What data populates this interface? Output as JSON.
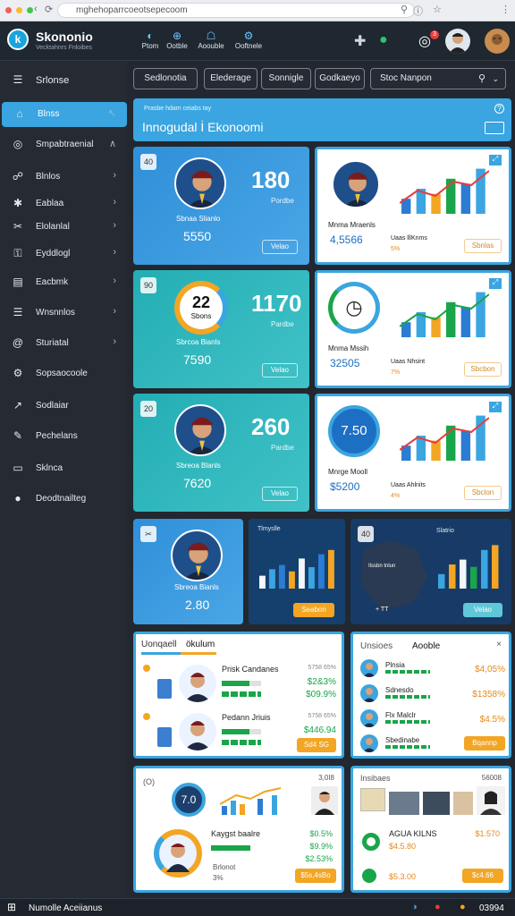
{
  "browser": {
    "url": "mghehoparrcoeotsepecoom"
  },
  "app": {
    "logo_letter": "k",
    "name": "Skononio",
    "tagline": "Vecktahnrs Fnloibes"
  },
  "topnav": [
    {
      "icon": "◐",
      "label": "Ptom"
    },
    {
      "icon": "⊕",
      "label": "Ootble"
    },
    {
      "icon": "☖",
      "label": "Aoouble"
    },
    {
      "icon": "⚙",
      "label": "Ooftnele"
    }
  ],
  "notif_count": "3",
  "sidebar": {
    "header": "Srlonse",
    "items": [
      {
        "icon": "⌂",
        "label": "Blnss",
        "chev": "↖",
        "active": true
      },
      {
        "icon": "◎",
        "label": "Smpabtraenial",
        "chev": "∧"
      },
      {
        "icon": "☍",
        "label": "Blnlos",
        "chev": "›"
      },
      {
        "icon": "✱",
        "label": "Eablaa",
        "chev": "›"
      },
      {
        "icon": "✂",
        "label": "Elolanlal",
        "chev": "›"
      },
      {
        "icon": "⚿",
        "label": "Eyddlogl",
        "chev": "›"
      },
      {
        "icon": "▤",
        "label": "Eacbmk",
        "chev": "›"
      },
      {
        "icon": "☰",
        "label": "Wnsnnlos",
        "chev": "›"
      },
      {
        "icon": "@",
        "label": "Sturiatal",
        "chev": "›"
      },
      {
        "icon": "⚙",
        "label": "Sopsaocoole",
        "chev": ""
      },
      {
        "icon": "↗",
        "label": "Sodlaiar",
        "chev": ""
      },
      {
        "icon": "✎",
        "label": "Pechelans",
        "chev": ""
      },
      {
        "icon": "▭",
        "label": "Sklnca",
        "chev": ""
      },
      {
        "icon": "●",
        "label": "Deodtnailteg",
        "chev": ""
      }
    ]
  },
  "filters": [
    "Sedlonotia",
    "Elederage",
    "Sonnigle",
    "Godkaeyo"
  ],
  "search": {
    "placeholder": "Stoc Nanpon"
  },
  "banner": {
    "sub": "Prasbe hdam ceiabs tay",
    "title": "Innogudal İ Ekonoomi",
    "badge": "?"
  },
  "cards": [
    {
      "kind": "blue",
      "badge": "40",
      "big": "180",
      "label": "Pordbe",
      "name": "Sbnaa Slianlo",
      "num": "5550",
      "btn": "Velao"
    },
    {
      "kind": "white",
      "name": "Mnma Mraenls",
      "num": "4,5566",
      "sub": "Uaas lllKnms",
      "subv": "5%",
      "btn": "Sbnlas"
    },
    {
      "kind": "teal",
      "badge": "90",
      "ring": "22",
      "ring_sub": "Sbons",
      "big": "1170",
      "label": "Pardbe",
      "name": "Sbrcoa Bianls",
      "num": "7590",
      "btn": "Velao"
    },
    {
      "kind": "white",
      "name": "Mnma Mssih",
      "num": "32505",
      "sub": "Uaas Nhsint",
      "subv": "7%",
      "btn": "Sbcbon"
    },
    {
      "kind": "teal",
      "badge": "20",
      "big": "260",
      "label": "Pardbe",
      "name": "Sbreoa Blanls",
      "num": "7620",
      "btn": "Velao"
    },
    {
      "kind": "white",
      "ring": "7.50",
      "name": "Mnrge Mooll",
      "num": "$5200",
      "sub": "Uaas Ahlnits",
      "subv": "4%",
      "btn": "Sbclon"
    },
    {
      "kind": "blue",
      "name": "Sbreoa Bianls",
      "num": "2.80"
    },
    {
      "kind": "navy",
      "label": "Tlmyslle",
      "btn": "Seabon"
    },
    {
      "kind": "map",
      "label": "Slatrio",
      "badge": "40",
      "ticks": "Ilssbn tnlun",
      "tag": "+ TT",
      "btn": "Velao"
    }
  ],
  "panel_left": {
    "tabs": [
      "Uonqaell",
      "ökulum"
    ],
    "rows": [
      {
        "title": "Prisk Candanes",
        "stat": "5758 65%",
        "v1": "$2&3%",
        "v2": "$09.9%"
      },
      {
        "title": "Pedann Jriuis",
        "stat": "5758 65%",
        "v1": "$446.94",
        "btn": "Sd4 SG"
      }
    ]
  },
  "panel_right": {
    "tabs": [
      "Unsioes",
      "Aooble"
    ],
    "rows": [
      {
        "title": "Plnsia",
        "v": "$4,05%"
      },
      {
        "title": "Sdnesdo",
        "v": "$1358%"
      },
      {
        "title": "Flx Malclr",
        "v": "$4.5%"
      },
      {
        "title": "Sbedinabe",
        "btn": "Bqannp"
      }
    ]
  },
  "bottom_left": {
    "badge": "(O)",
    "corner": "3,0I8",
    "ring": "7.0",
    "title": "Kaygst baalre",
    "v1": "$0.5%",
    "v2": "$9.9%",
    "v3": "$2.53%",
    "small": "Brlonot",
    "btn": "$5s,4sBo",
    "pct": "3%"
  },
  "bottom_right": {
    "title": "Insibaes",
    "corner": "56008",
    "head": "AGUA KILNS",
    "v1": "$4.5.80",
    "v2": "$1.570",
    "v3": "$5.3.00",
    "btn": "$c4.66"
  },
  "statusbar": {
    "left": "Numolle Aceiianus",
    "right": "03994"
  },
  "colors": {
    "accent": "#3aa5e0",
    "teal": "#23aeb4",
    "orange": "#f3a524",
    "green": "#19a54a"
  }
}
